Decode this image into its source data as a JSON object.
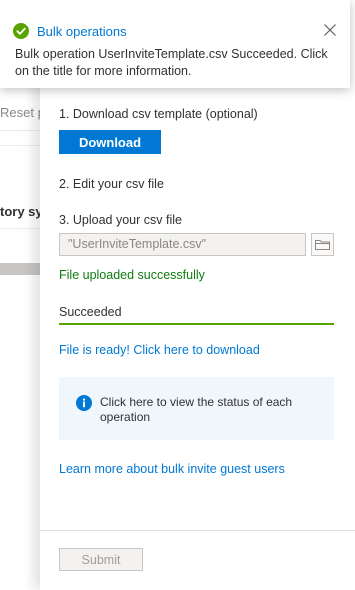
{
  "background": {
    "reset_label": "Reset p",
    "history_label": "tory sy"
  },
  "toast": {
    "title": "Bulk operations",
    "message": "Bulk operation UserInviteTemplate.csv Succeeded. Click on the title for more information.",
    "status_color": "#57a300"
  },
  "panel": {
    "step1_label": "1. Download csv template (optional)",
    "download_button": "Download",
    "step2_label": "2. Edit your csv file",
    "step3_label": "3. Upload your csv file",
    "file_input_value": "\"UserInviteTemplate.csv\"",
    "upload_status": "File uploaded successfully",
    "operation_status": "Succeeded",
    "operation_progress_percent": 100,
    "file_ready_link": "File is ready! Click here to download",
    "info_text": "Click here to view the status of each operation",
    "learn_more_link": "Learn more about bulk invite guest users",
    "submit_button": "Submit"
  },
  "colors": {
    "accent": "#0078d4",
    "success": "#107c10",
    "success_bar": "#57a300",
    "info_bg": "#eff6fc"
  }
}
